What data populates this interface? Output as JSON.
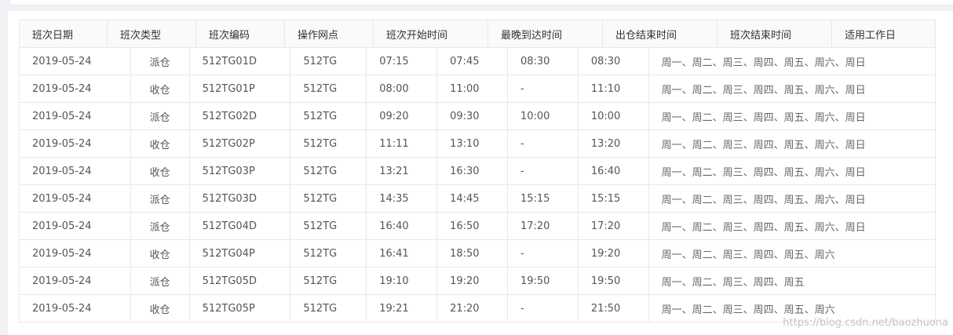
{
  "table": {
    "headers": [
      "班次日期",
      "班次类型",
      "班次编码",
      "操作网点",
      "班次开始时间",
      "最晚到达时间",
      "出仓结束时间",
      "班次结束时间",
      "适用工作日"
    ],
    "rows": [
      [
        "2019-05-24",
        "派仓",
        "512TG01D",
        "512TG",
        "07:15",
        "07:45",
        "08:30",
        "08:30",
        "周一、周二、周三、周四、周五、周六、周日"
      ],
      [
        "2019-05-24",
        "收仓",
        "512TG01P",
        "512TG",
        "08:00",
        "11:00",
        "-",
        "11:10",
        "周一、周二、周三、周四、周五、周六、周日"
      ],
      [
        "2019-05-24",
        "派仓",
        "512TG02D",
        "512TG",
        "09:20",
        "09:30",
        "10:00",
        "10:00",
        "周一、周二、周三、周四、周五、周六、周日"
      ],
      [
        "2019-05-24",
        "收仓",
        "512TG02P",
        "512TG",
        "11:11",
        "13:10",
        "-",
        "13:20",
        "周一、周二、周三、周四、周五、周六、周日"
      ],
      [
        "2019-05-24",
        "收仓",
        "512TG03P",
        "512TG",
        "13:21",
        "16:30",
        "-",
        "16:40",
        "周一、周二、周三、周四、周五、周六、周日"
      ],
      [
        "2019-05-24",
        "派仓",
        "512TG03D",
        "512TG",
        "14:35",
        "14:45",
        "15:15",
        "15:15",
        "周一、周二、周三、周四、周五、周六、周日"
      ],
      [
        "2019-05-24",
        "派仓",
        "512TG04D",
        "512TG",
        "16:40",
        "16:50",
        "17:20",
        "17:20",
        "周一、周二、周三、周四、周五、周六、周日"
      ],
      [
        "2019-05-24",
        "收仓",
        "512TG04P",
        "512TG",
        "16:41",
        "18:50",
        "-",
        "19:20",
        "周一、周二、周三、周四、周五、周六"
      ],
      [
        "2019-05-24",
        "派仓",
        "512TG05D",
        "512TG",
        "19:10",
        "19:20",
        "19:50",
        "19:50",
        "周一、周二、周三、周四、周五"
      ],
      [
        "2019-05-24",
        "收仓",
        "512TG05P",
        "512TG",
        "19:21",
        "21:20",
        "-",
        "21:50",
        "周一、周二、周三、周四、周五、周六"
      ]
    ]
  },
  "watermark": "https://blog.csdn.net/baozhuona"
}
